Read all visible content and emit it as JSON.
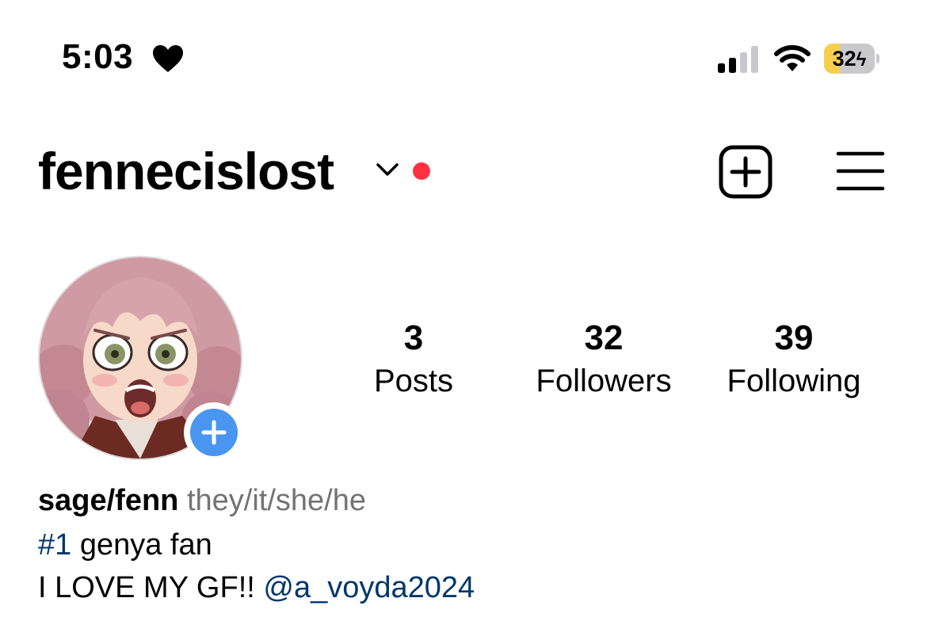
{
  "status_bar": {
    "time": "5:03",
    "heart_icon": "heart-icon",
    "battery_level": "32",
    "battery_fraction": 0.32,
    "battery_color": "#f6d04d",
    "charging": true
  },
  "header": {
    "username": "fennecislost",
    "has_notification_dot": true,
    "notification_color": "#ff3040",
    "icons": [
      "chevron-down-icon",
      "new-post-icon",
      "menu-icon"
    ]
  },
  "profile": {
    "avatar_icon": "avatar",
    "add_story_color": "#4a95f0"
  },
  "stats": {
    "posts": {
      "value": "3",
      "label": "Posts"
    },
    "followers": {
      "value": "32",
      "label": "Followers"
    },
    "following": {
      "value": "39",
      "label": "Following"
    }
  },
  "bio": {
    "name": "sage/fenn",
    "pronouns": "they/it/she/he",
    "line1_hashtag": "#1",
    "line1_text": " genya fan",
    "line2_text": "I LOVE MY GF!! ",
    "line2_mention": "@a_voyda2024",
    "link_color": "#00376b"
  }
}
